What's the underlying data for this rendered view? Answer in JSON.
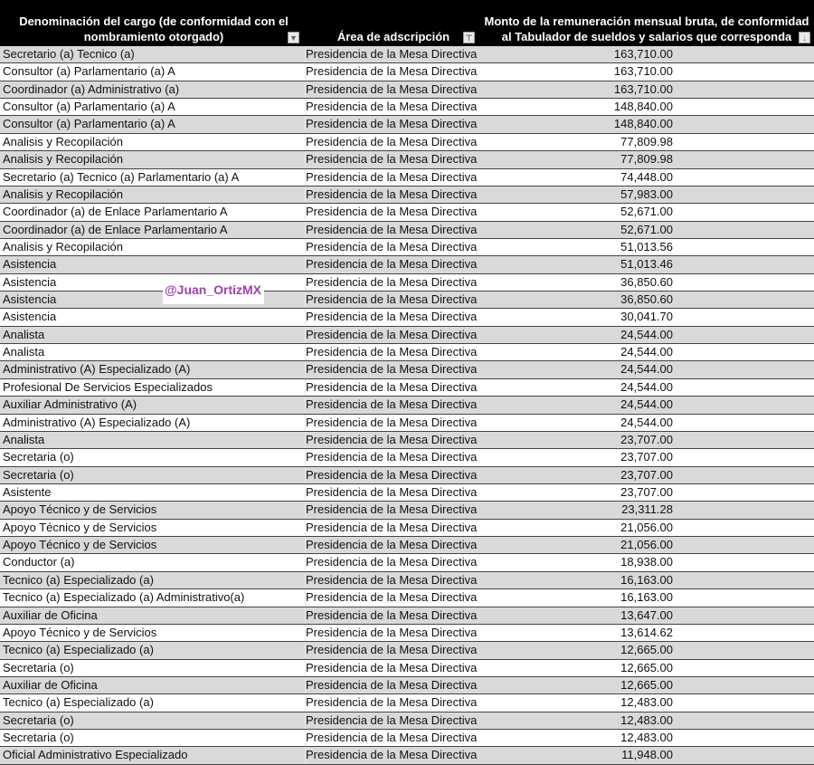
{
  "header": {
    "col1": "Denominación del cargo (de conformidad con el nombramiento otorgado)",
    "col2": "Área de adscripción",
    "col3": "Monto de la remuneración mensual bruta, de conformidad al Tabulador de sueldos y salarios que corresponda"
  },
  "watermark": "@Juan_OrtizMX",
  "rows": [
    [
      "Secretario (a) Tecnico (a)",
      "Presidencia de la Mesa Directiva",
      "163,710.00"
    ],
    [
      "Consultor (a) Parlamentario (a) A",
      "Presidencia de la Mesa Directiva",
      "163,710.00"
    ],
    [
      "Coordinador (a) Administrativo (a)",
      "Presidencia de la Mesa Directiva",
      "163,710.00"
    ],
    [
      "Consultor (a) Parlamentario (a) A",
      "Presidencia de la Mesa Directiva",
      "148,840.00"
    ],
    [
      "Consultor (a) Parlamentario (a) A",
      "Presidencia de la Mesa Directiva",
      "148,840.00"
    ],
    [
      "Analisis y Recopilación",
      "Presidencia de la Mesa Directiva",
      "77,809.98"
    ],
    [
      "Analisis y Recopilación",
      "Presidencia de la Mesa Directiva",
      "77,809.98"
    ],
    [
      "Secretario (a) Tecnico (a) Parlamentario (a) A",
      "Presidencia de la Mesa Directiva",
      "74,448.00"
    ],
    [
      "Analisis y Recopilación",
      "Presidencia de la Mesa Directiva",
      "57,983.00"
    ],
    [
      "Coordinador (a) de Enlace Parlamentario A",
      "Presidencia de la Mesa Directiva",
      "52,671.00"
    ],
    [
      "Coordinador (a) de Enlace Parlamentario A",
      "Presidencia de la Mesa Directiva",
      "52,671.00"
    ],
    [
      "Analisis y Recopilación",
      "Presidencia de la Mesa Directiva",
      "51,013.56"
    ],
    [
      "Asistencia",
      "Presidencia de la Mesa Directiva",
      "51,013.46"
    ],
    [
      "Asistencia",
      "Presidencia de la Mesa Directiva",
      "36,850.60"
    ],
    [
      "Asistencia",
      "Presidencia de la Mesa Directiva",
      "36,850.60"
    ],
    [
      "Asistencia",
      "Presidencia de la Mesa Directiva",
      "30,041.70"
    ],
    [
      "Analista",
      "Presidencia de la Mesa Directiva",
      "24,544.00"
    ],
    [
      "Analista",
      "Presidencia de la Mesa Directiva",
      "24,544.00"
    ],
    [
      "Administrativo (A) Especializado (A)",
      "Presidencia de la Mesa Directiva",
      "24,544.00"
    ],
    [
      "Profesional De Servicios Especializados",
      "Presidencia de la Mesa Directiva",
      "24,544.00"
    ],
    [
      "Auxiliar Administrativo (A)",
      "Presidencia de la Mesa Directiva",
      "24,544.00"
    ],
    [
      "Administrativo (A) Especializado (A)",
      "Presidencia de la Mesa Directiva",
      "24,544.00"
    ],
    [
      "Analista",
      "Presidencia de la Mesa Directiva",
      "23,707.00"
    ],
    [
      "Secretaria (o)",
      "Presidencia de la Mesa Directiva",
      "23,707.00"
    ],
    [
      "Secretaria (o)",
      "Presidencia de la Mesa Directiva",
      "23,707.00"
    ],
    [
      "Asistente",
      "Presidencia de la Mesa Directiva",
      "23,707.00"
    ],
    [
      "Apoyo Técnico y de Servicios",
      "Presidencia de la Mesa Directiva",
      "23,311.28"
    ],
    [
      "Apoyo Técnico y de Servicios",
      "Presidencia de la Mesa Directiva",
      "21,056.00"
    ],
    [
      "Apoyo Técnico y de Servicios",
      "Presidencia de la Mesa Directiva",
      "21,056.00"
    ],
    [
      "Conductor (a)",
      "Presidencia de la Mesa Directiva",
      "18,938.00"
    ],
    [
      "Tecnico (a) Especializado (a)",
      "Presidencia de la Mesa Directiva",
      "16,163.00"
    ],
    [
      "Tecnico (a) Especializado (a) Administrativo(a)",
      "Presidencia de la Mesa Directiva",
      "16,163.00"
    ],
    [
      "Auxiliar de Oficina",
      "Presidencia de la Mesa Directiva",
      "13,647.00"
    ],
    [
      "Apoyo Técnico y de Servicios",
      "Presidencia de la Mesa Directiva",
      "13,614.62"
    ],
    [
      "Tecnico (a) Especializado (a)",
      "Presidencia de la Mesa Directiva",
      "12,665.00"
    ],
    [
      "Secretaria (o)",
      "Presidencia de la Mesa Directiva",
      "12,665.00"
    ],
    [
      "Auxiliar de Oficina",
      "Presidencia de la Mesa Directiva",
      "12,665.00"
    ],
    [
      "Tecnico (a) Especializado (a)",
      "Presidencia de la Mesa Directiva",
      "12,483.00"
    ],
    [
      "Secretaria (o)",
      "Presidencia de la Mesa Directiva",
      "12,483.00"
    ],
    [
      "Secretaria (o)",
      "Presidencia de la Mesa Directiva",
      "12,483.00"
    ],
    [
      "Oficial Administrativo Especializado",
      "Presidencia de la Mesa Directiva",
      "11,948.00"
    ]
  ]
}
